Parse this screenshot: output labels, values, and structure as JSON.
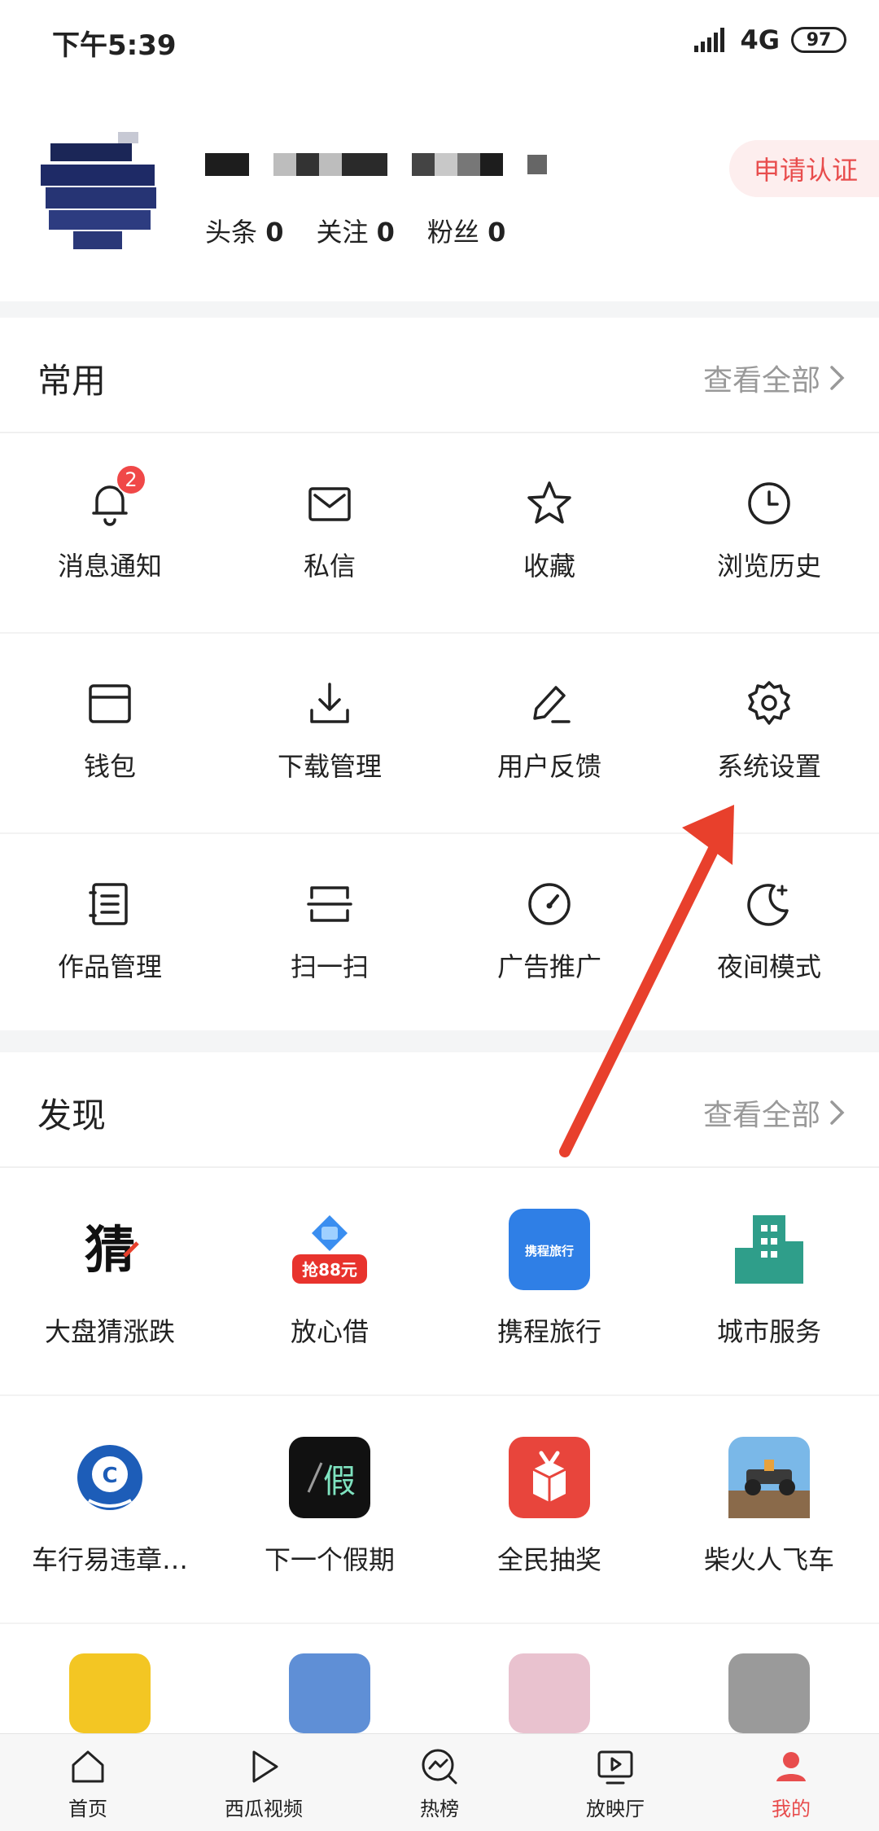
{
  "status_bar": {
    "time": "下午5:39",
    "network": "4G",
    "battery": "97"
  },
  "profile": {
    "stats": [
      {
        "label": "头条",
        "value": "0"
      },
      {
        "label": "关注",
        "value": "0"
      },
      {
        "label": "粉丝",
        "value": "0"
      }
    ],
    "verify_label": "申请认证"
  },
  "common": {
    "title": "常用",
    "more_label": "查看全部",
    "items": [
      {
        "label": "消息通知",
        "icon": "bell-icon",
        "badge": "2"
      },
      {
        "label": "私信",
        "icon": "mail-icon"
      },
      {
        "label": "收藏",
        "icon": "star-icon"
      },
      {
        "label": "浏览历史",
        "icon": "clock-icon"
      },
      {
        "label": "钱包",
        "icon": "wallet-icon"
      },
      {
        "label": "下载管理",
        "icon": "download-icon"
      },
      {
        "label": "用户反馈",
        "icon": "pencil-icon"
      },
      {
        "label": "系统设置",
        "icon": "gear-icon"
      },
      {
        "label": "作品管理",
        "icon": "notebook-icon"
      },
      {
        "label": "扫一扫",
        "icon": "scan-icon"
      },
      {
        "label": "广告推广",
        "icon": "gauge-icon"
      },
      {
        "label": "夜间模式",
        "icon": "moon-icon"
      }
    ]
  },
  "discover": {
    "title": "发现",
    "more_label": "查看全部",
    "items": [
      {
        "label": "大盘猜涨跌",
        "icon": "guess-app-icon",
        "icon_text": "猜"
      },
      {
        "label": "放心借",
        "icon": "loan-app-icon",
        "icon_text": "抢88元"
      },
      {
        "label": "携程旅行",
        "icon": "ctrip-app-icon",
        "icon_text": "携程旅行"
      },
      {
        "label": "城市服务",
        "icon": "city-app-icon"
      },
      {
        "label": "车行易违章…",
        "icon": "car-app-icon"
      },
      {
        "label": "下一个假期",
        "icon": "holiday-app-icon",
        "icon_text": "假"
      },
      {
        "label": "全民抽奖",
        "icon": "lottery-app-icon"
      },
      {
        "label": "柴火人飞车",
        "icon": "racing-app-icon"
      }
    ]
  },
  "tabbar": {
    "items": [
      {
        "label": "首页",
        "icon": "home-icon"
      },
      {
        "label": "西瓜视频",
        "icon": "play-icon"
      },
      {
        "label": "热榜",
        "icon": "trend-icon"
      },
      {
        "label": "放映厅",
        "icon": "screen-icon"
      },
      {
        "label": "我的",
        "icon": "profile-icon",
        "active": true
      }
    ]
  },
  "colors": {
    "accent": "#e84d4d",
    "arrow": "#e8402c"
  }
}
